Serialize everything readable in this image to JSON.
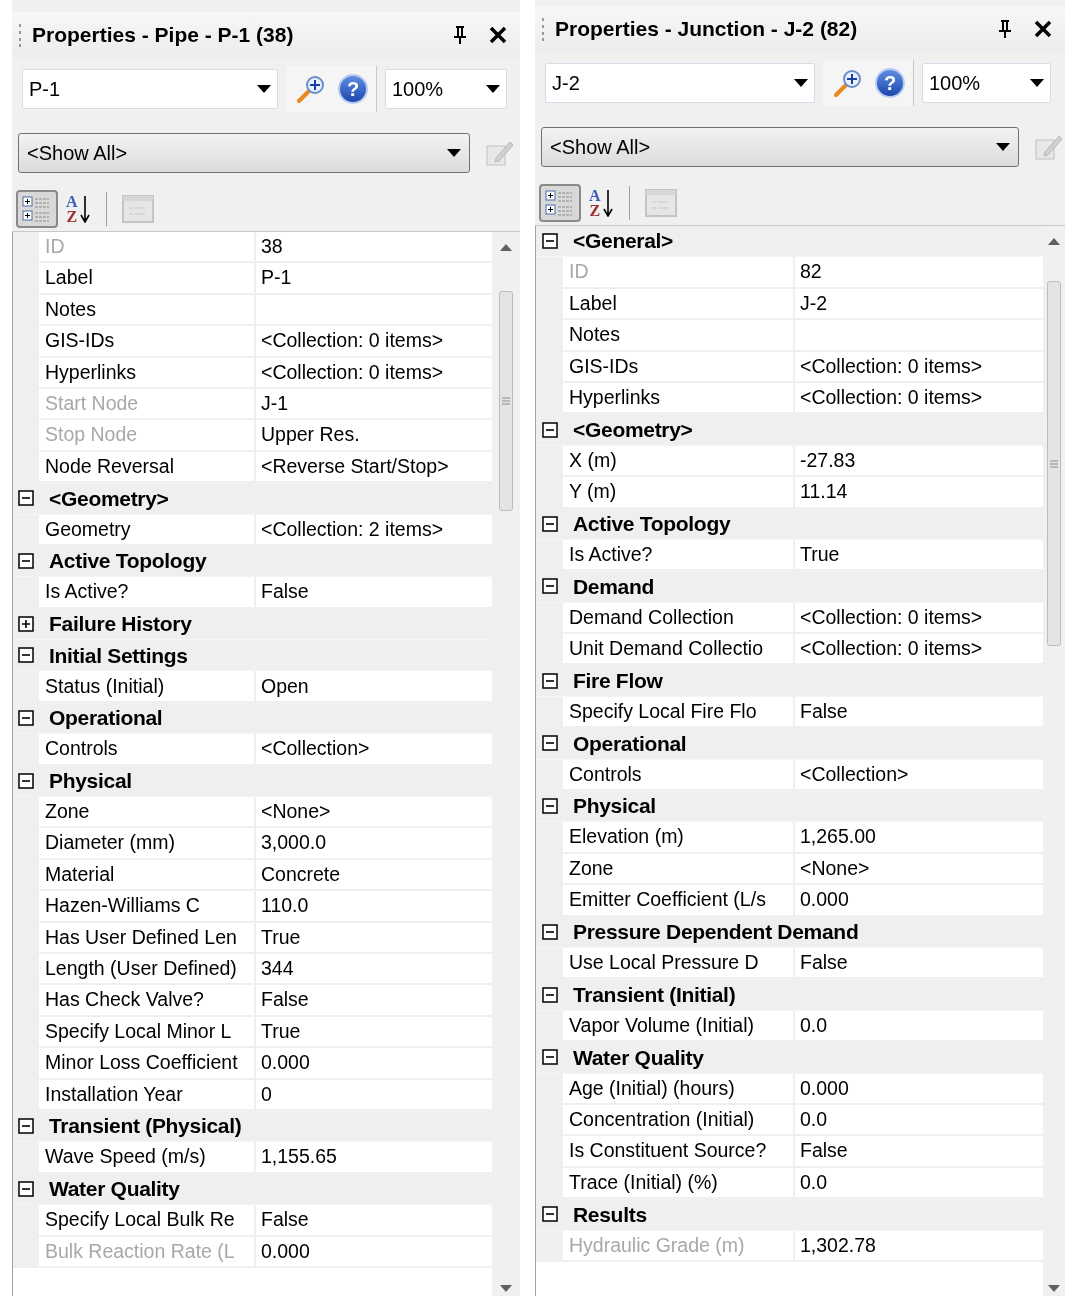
{
  "panels": [
    {
      "title": "Properties - Pipe - P-1 (38)",
      "element": "P-1",
      "zoom": "100%",
      "filter": "<Show All>",
      "toolbar": [
        {
          "kind": "categorized",
          "selected": true
        },
        {
          "kind": "alphabetical",
          "selected": false,
          "glyphs": [
            "A",
            "Z"
          ]
        },
        {
          "kind": "pages",
          "disabled": true
        }
      ],
      "help_glyph": "?",
      "rows": [
        {
          "kind": "property",
          "label": "ID",
          "value": "38",
          "readonly": true
        },
        {
          "kind": "property",
          "label": "Label",
          "value": "P-1",
          "readonly": false
        },
        {
          "kind": "property",
          "label": "Notes",
          "readonly": false
        },
        {
          "kind": "property",
          "label": "GIS-IDs",
          "value": "<Collection: 0 items>",
          "readonly": false
        },
        {
          "kind": "property",
          "label": "Hyperlinks",
          "value": "<Collection: 0 items>",
          "readonly": false
        },
        {
          "kind": "property",
          "label": "Start Node",
          "value": "J-1",
          "readonly": true
        },
        {
          "kind": "property",
          "label": "Stop Node",
          "value": "Upper Res.",
          "readonly": true
        },
        {
          "kind": "property",
          "label": "Node Reversal",
          "value": "<Reverse Start/Stop>",
          "readonly": false
        },
        {
          "kind": "category",
          "label": "<Geometry>",
          "expanded": true
        },
        {
          "kind": "property",
          "label": "Geometry",
          "value": "<Collection: 2 items>",
          "readonly": false
        },
        {
          "kind": "category",
          "label": "Active Topology",
          "expanded": true
        },
        {
          "kind": "property",
          "label": "Is Active?",
          "value": "False",
          "readonly": false
        },
        {
          "kind": "category",
          "label": "Failure History",
          "expanded": false
        },
        {
          "kind": "category",
          "label": "Initial Settings",
          "expanded": true
        },
        {
          "kind": "property",
          "label": "Status (Initial)",
          "value": "Open",
          "readonly": false
        },
        {
          "kind": "category",
          "label": "Operational",
          "expanded": true
        },
        {
          "kind": "property",
          "label": "Controls",
          "value": "<Collection>",
          "readonly": false
        },
        {
          "kind": "category",
          "label": "Physical",
          "expanded": true
        },
        {
          "kind": "property",
          "label": "Zone",
          "value": "<None>",
          "readonly": false
        },
        {
          "kind": "property",
          "label": "Diameter (mm)",
          "value": "3,000.0",
          "readonly": false
        },
        {
          "kind": "property",
          "label": "Material",
          "value": "Concrete",
          "readonly": false
        },
        {
          "kind": "property",
          "label": "Hazen-Williams C",
          "value": "110.0",
          "readonly": false
        },
        {
          "kind": "property",
          "label": "Has User Defined Len",
          "value": "True",
          "readonly": false
        },
        {
          "kind": "property",
          "label": "Length (User Defined)",
          "value": "344",
          "readonly": false
        },
        {
          "kind": "property",
          "label": "Has Check Valve?",
          "value": "False",
          "readonly": false
        },
        {
          "kind": "property",
          "label": "Specify Local Minor L",
          "value": "True",
          "readonly": false
        },
        {
          "kind": "property",
          "label": "Minor Loss Coefficient",
          "value": "0.000",
          "readonly": false
        },
        {
          "kind": "property",
          "label": "Installation Year",
          "value": "0",
          "readonly": false
        },
        {
          "kind": "category",
          "label": "Transient (Physical)",
          "expanded": true
        },
        {
          "kind": "property",
          "label": "Wave Speed (m/s)",
          "value": "1,155.65",
          "readonly": false
        },
        {
          "kind": "category",
          "label": "Water Quality",
          "expanded": true
        },
        {
          "kind": "property",
          "label": "Specify Local Bulk Re",
          "value": "False",
          "readonly": false
        },
        {
          "kind": "property",
          "label": "Bulk Reaction Rate (L",
          "value": "0.000",
          "readonly": true
        }
      ]
    },
    {
      "title": "Properties - Junction - J-2 (82)",
      "element": "J-2",
      "zoom": "100%",
      "filter": "<Show All>",
      "toolbar": [
        {
          "kind": "categorized",
          "selected": true
        },
        {
          "kind": "alphabetical",
          "selected": false,
          "glyphs": [
            "A",
            "Z"
          ]
        },
        {
          "kind": "pages",
          "disabled": true
        }
      ],
      "help_glyph": "?",
      "rows": [
        {
          "kind": "category",
          "label": "<General>",
          "expanded": true
        },
        {
          "kind": "property",
          "label": "ID",
          "value": "82",
          "readonly": true
        },
        {
          "kind": "property",
          "label": "Label",
          "value": "J-2",
          "readonly": false
        },
        {
          "kind": "property",
          "label": "Notes",
          "readonly": false
        },
        {
          "kind": "property",
          "label": "GIS-IDs",
          "value": "<Collection: 0 items>",
          "readonly": false
        },
        {
          "kind": "property",
          "label": "Hyperlinks",
          "value": "<Collection: 0 items>",
          "readonly": false
        },
        {
          "kind": "category",
          "label": "<Geometry>",
          "expanded": true
        },
        {
          "kind": "property",
          "label": "X (m)",
          "value": "-27.83",
          "readonly": false
        },
        {
          "kind": "property",
          "label": "Y (m)",
          "value": "11.14",
          "readonly": false
        },
        {
          "kind": "category",
          "label": "Active Topology",
          "expanded": true
        },
        {
          "kind": "property",
          "label": "Is Active?",
          "value": "True",
          "readonly": false
        },
        {
          "kind": "category",
          "label": "Demand",
          "expanded": true
        },
        {
          "kind": "property",
          "label": "Demand Collection",
          "value": "<Collection: 0 items>",
          "readonly": false
        },
        {
          "kind": "property",
          "label": "Unit Demand Collectio",
          "value": "<Collection: 0 items>",
          "readonly": false
        },
        {
          "kind": "category",
          "label": "Fire Flow",
          "expanded": true
        },
        {
          "kind": "property",
          "label": "Specify Local Fire Flo",
          "value": "False",
          "readonly": false
        },
        {
          "kind": "category",
          "label": "Operational",
          "expanded": true
        },
        {
          "kind": "property",
          "label": "Controls",
          "value": "<Collection>",
          "readonly": false
        },
        {
          "kind": "category",
          "label": "Physical",
          "expanded": true
        },
        {
          "kind": "property",
          "label": "Elevation (m)",
          "value": "1,265.00",
          "readonly": false
        },
        {
          "kind": "property",
          "label": "Zone",
          "value": "<None>",
          "readonly": false
        },
        {
          "kind": "property",
          "label": "Emitter Coefficient (L/s",
          "value": "0.000",
          "readonly": false
        },
        {
          "kind": "category",
          "label": "Pressure Dependent Demand",
          "expanded": true
        },
        {
          "kind": "property",
          "label": "Use Local Pressure D",
          "value": "False",
          "readonly": false
        },
        {
          "kind": "category",
          "label": "Transient (Initial)",
          "expanded": true
        },
        {
          "kind": "property",
          "label": "Vapor Volume (Initial)",
          "value": "0.0",
          "readonly": false
        },
        {
          "kind": "category",
          "label": "Water Quality",
          "expanded": true
        },
        {
          "kind": "property",
          "label": "Age (Initial) (hours)",
          "value": "0.000",
          "readonly": false
        },
        {
          "kind": "property",
          "label": "Concentration (Initial)",
          "value": "0.0",
          "readonly": false
        },
        {
          "kind": "property",
          "label": "Is Constituent Source?",
          "value": "False",
          "readonly": false
        },
        {
          "kind": "property",
          "label": "Trace (Initial) (%)",
          "value": "0.0",
          "readonly": false
        },
        {
          "kind": "category",
          "label": "Results",
          "expanded": true
        },
        {
          "kind": "property",
          "label": "Hydraulic Grade (m)",
          "value": "1,302.78",
          "readonly": true
        }
      ]
    }
  ]
}
